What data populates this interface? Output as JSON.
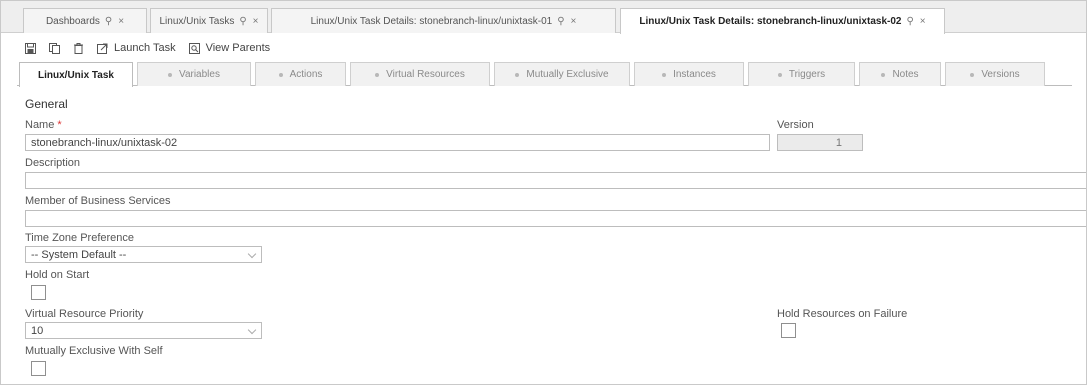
{
  "top_tabs": [
    {
      "label": "Dashboards",
      "pin": "⚲",
      "close": "×"
    },
    {
      "label": "Linux/Unix Tasks",
      "pin": "⚲",
      "close": "×"
    },
    {
      "label": "Linux/Unix Task Details: stonebranch-linux/unixtask-01",
      "pin": "⚲",
      "close": "×"
    },
    {
      "label": "Linux/Unix Task Details: stonebranch-linux/unixtask-02",
      "pin": "⚲",
      "close": "×"
    }
  ],
  "toolbar": {
    "save_icon": "save-icon",
    "copy_icon": "copy-icon",
    "delete_icon": "trash-icon",
    "launch_label": "Launch Task",
    "view_parents_label": "View Parents"
  },
  "sub_tabs": [
    "Linux/Unix Task",
    "Variables",
    "Actions",
    "Virtual Resources",
    "Mutually Exclusive",
    "Instances",
    "Triggers",
    "Notes",
    "Versions"
  ],
  "form": {
    "section_title": "General",
    "name_label": "Name",
    "name_required_marker": "*",
    "name_value": "stonebranch-linux/unixtask-02",
    "version_label": "Version",
    "version_value": "1",
    "description_label": "Description",
    "description_value": "",
    "business_services_label": "Member of Business Services",
    "business_services_value": "",
    "timezone_label": "Time Zone Preference",
    "timezone_value": "-- System Default --",
    "hold_on_start_label": "Hold on Start",
    "vr_priority_label": "Virtual Resource Priority",
    "vr_priority_value": "10",
    "hold_resources_label": "Hold Resources on Failure",
    "mutually_exclusive_label": "Mutually Exclusive With Self"
  }
}
